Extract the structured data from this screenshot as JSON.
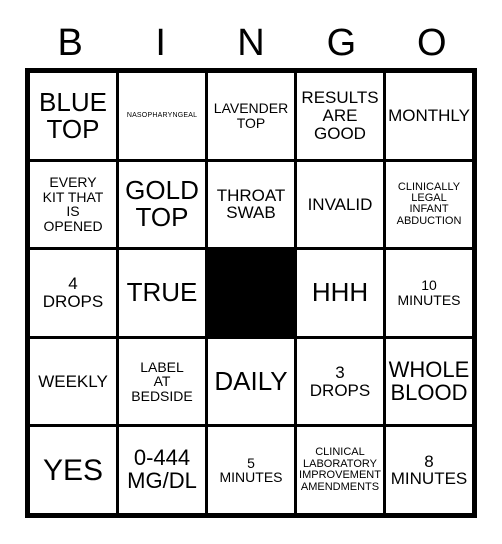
{
  "card": {
    "title_letters": [
      "B",
      "I",
      "N",
      "G",
      "O"
    ],
    "free_space": {
      "row": 3,
      "column": 3,
      "color": "#000000",
      "label": ""
    },
    "colors": {
      "ink": "#000000",
      "paper": "#ffffff",
      "free_space": "#000000"
    },
    "rows": [
      [
        {
          "text": "BLUE\nTOP",
          "size": "xl"
        },
        {
          "text": "NASOPHARYNGEAL",
          "size": "xxs"
        },
        {
          "text": "LAVENDER\nTOP",
          "size": "sm"
        },
        {
          "text": "RESULTS\nARE\nGOOD",
          "size": "md"
        },
        {
          "text": "MONTHLY",
          "size": "md"
        }
      ],
      [
        {
          "text": "EVERY\nKIT THAT\nIS\nOPENED",
          "size": "sm"
        },
        {
          "text": "GOLD\nTOP",
          "size": "xl"
        },
        {
          "text": "THROAT\nSWAB",
          "size": "md"
        },
        {
          "text": "INVALID",
          "size": "md"
        },
        {
          "text": "CLINICALLY\nLEGAL\nINFANT\nABDUCTION",
          "size": "xs"
        }
      ],
      [
        {
          "text": "4\nDROPS",
          "size": "md"
        },
        {
          "text": "TRUE",
          "size": "xl"
        },
        {
          "text": "",
          "size": "md",
          "free": true
        },
        {
          "text": "HHH",
          "size": "xl"
        },
        {
          "text": "10\nMINUTES",
          "size": "sm"
        }
      ],
      [
        {
          "text": "WEEKLY",
          "size": "md"
        },
        {
          "text": "LABEL\nAT\nBEDSIDE",
          "size": "sm"
        },
        {
          "text": "DAILY",
          "size": "xl"
        },
        {
          "text": "3\nDROPS",
          "size": "md"
        },
        {
          "text": "WHOLE\nBLOOD",
          "size": "lg"
        }
      ],
      [
        {
          "text": "YES",
          "size": "xxl"
        },
        {
          "text": "0-444\nMG/DL",
          "size": "lg"
        },
        {
          "text": "5\nMINUTES",
          "size": "sm"
        },
        {
          "text": "CLINICAL\nLABORATORY\nIMPROVEMENT\nAMENDMENTS",
          "size": "xs"
        },
        {
          "text": "8\nMINUTES",
          "size": "md"
        }
      ]
    ]
  }
}
